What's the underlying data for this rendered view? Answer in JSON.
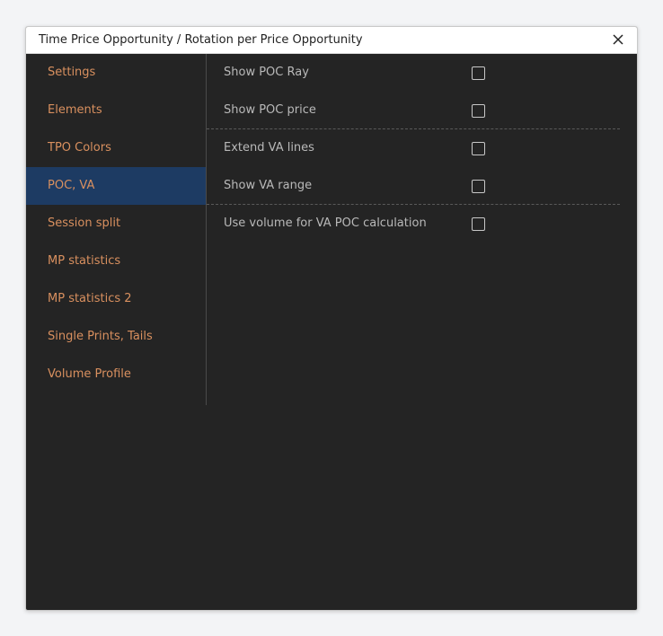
{
  "dialog": {
    "title": "Time Price Opportunity / Rotation per Price Opportunity",
    "close_icon": "close-icon"
  },
  "sidebar": {
    "active_index": 3,
    "items": [
      {
        "label": "Settings"
      },
      {
        "label": "Elements"
      },
      {
        "label": "TPO Colors"
      },
      {
        "label": "POC, VA"
      },
      {
        "label": "Session split"
      },
      {
        "label": "MP statistics"
      },
      {
        "label": "MP statistics 2"
      },
      {
        "label": "Single Prints, Tails"
      },
      {
        "label": "Volume Profile"
      }
    ]
  },
  "content": {
    "options": [
      {
        "label": "Show POC Ray",
        "checked": false
      },
      {
        "label": "Show POC price",
        "checked": false
      },
      {
        "label": "Extend VA lines",
        "checked": false
      },
      {
        "label": "Show VA range",
        "checked": false
      },
      {
        "label": "Use volume for VA POC calculation",
        "checked": false
      }
    ]
  },
  "colors": {
    "dialog_bg": "#242424",
    "sidebar_label": "#d9905f",
    "active_bg": "#1d3b63",
    "option_label": "#b9b9b9",
    "page_bg": "#f3f4f6"
  }
}
